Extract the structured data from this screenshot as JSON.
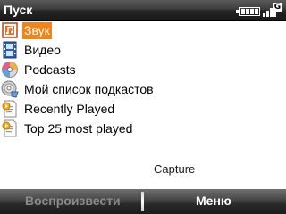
{
  "titlebar": {
    "title": "Пуск"
  },
  "status": {
    "network": "G",
    "battery_icon": "battery-icon",
    "signal_icon": "signal-icon"
  },
  "list": {
    "items": [
      {
        "label": "Звук",
        "icon": "sound-icon",
        "selected": true
      },
      {
        "label": "Видео",
        "icon": "video-film-icon"
      },
      {
        "label": "Podcasts",
        "icon": "podcast-disc-icon"
      },
      {
        "label": "Мой список подкастов",
        "icon": "podcast-list-icon"
      },
      {
        "label": "Recently Played",
        "icon": "playlist-icon"
      },
      {
        "label": "Top 25 most played",
        "icon": "playlist-icon"
      }
    ]
  },
  "capture_label": "Capture",
  "softkeys": {
    "left": "Воспроизвести",
    "right": "Меню"
  },
  "colors": {
    "selection": "#f08418",
    "titlebar": "#2a2a2a"
  }
}
